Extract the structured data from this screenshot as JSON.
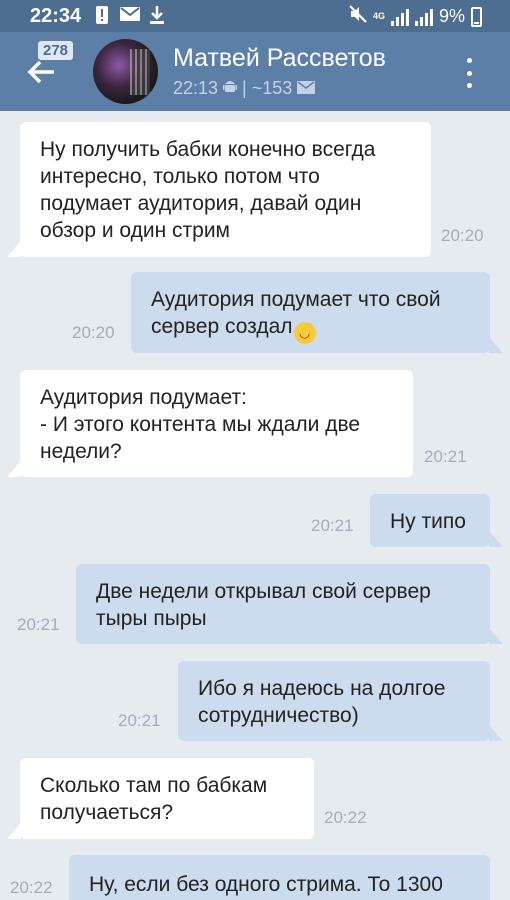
{
  "status_bar": {
    "time": "22:34",
    "network": "4G",
    "battery": "9%"
  },
  "header": {
    "unread_count": "278",
    "contact_name": "Матвей Рассветов",
    "last_seen": "22:13",
    "separator": "|",
    "message_count": "~153"
  },
  "messages": [
    {
      "direction": "in",
      "text": "Ну получить бабки конечно всегда\nинтересно, только потом что\nподумает аудитория, давай один\nобзор и один стрим",
      "time": "20:20"
    },
    {
      "direction": "out",
      "text": "Аудитория подумает что свой\nсервер создал",
      "emoji": "smile-emoji",
      "time": "20:20"
    },
    {
      "direction": "in",
      "text": "Аудитория подумает:\n- И этого контента мы ждали две\nнедели?",
      "time": "20:21"
    },
    {
      "direction": "out",
      "text": "Ну типо",
      "time": "20:21"
    },
    {
      "direction": "out",
      "text": "Две недели открывал свой сервер\nтыры пыры",
      "time": "20:21"
    },
    {
      "direction": "out",
      "text": "Ибо я надеюсь на долгое\nсотрудничество)",
      "time": "20:21"
    },
    {
      "direction": "in",
      "text": "Сколько там по бабкам\nполучаеться?",
      "time": "20:22"
    },
    {
      "direction": "out",
      "text": "Ну, если без одного стрима. То 1300",
      "time": "20:22"
    }
  ],
  "icons": {
    "back": "arrow-left-icon",
    "more": "more-vertical-icon",
    "android": "android-icon",
    "mail": "mail-icon"
  }
}
